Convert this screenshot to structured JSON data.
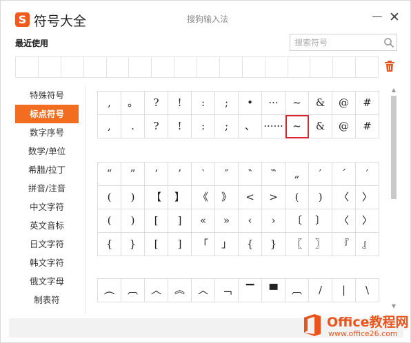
{
  "titlebar": {
    "logo_text": "S",
    "title": "符号大全",
    "center_title": "搜狗输入法",
    "minimize_label": "—",
    "close_label": "✕"
  },
  "recent": {
    "label": "最近使用",
    "cells": 16
  },
  "search": {
    "placeholder": "搜索符号",
    "value": ""
  },
  "sidebar": {
    "items": [
      {
        "label": "特殊符号",
        "active": false
      },
      {
        "label": "标点符号",
        "active": true
      },
      {
        "label": "数字序号",
        "active": false
      },
      {
        "label": "数学/单位",
        "active": false
      },
      {
        "label": "希腊/拉丁",
        "active": false
      },
      {
        "label": "拼音/注音",
        "active": false
      },
      {
        "label": "中文字符",
        "active": false
      },
      {
        "label": "英文音标",
        "active": false
      },
      {
        "label": "日文字符",
        "active": false
      },
      {
        "label": "韩文字符",
        "active": false
      },
      {
        "label": "俄文字母",
        "active": false
      },
      {
        "label": "制表符",
        "active": false
      }
    ]
  },
  "symbol_groups": [
    {
      "rows": [
        [
          ",",
          "。",
          "?",
          "!",
          ":",
          ";",
          "•",
          "···",
          "~",
          "&",
          "@",
          "#"
        ],
        [
          ",",
          ".",
          "?",
          "!",
          ":",
          ";",
          "、",
          "······",
          "~",
          "&",
          "@",
          "#"
        ]
      ],
      "selected": [
        1,
        8
      ]
    },
    {
      "rows": [
        [
          "“",
          "”",
          "‘",
          "’",
          "‵",
          "″",
          "‶",
          "‷",
          "„",
          "′",
          "´",
          "′"
        ],
        [
          "(",
          ")",
          "【",
          "】",
          "《",
          "》",
          "<",
          ">",
          "(",
          ")",
          "〈",
          "〉"
        ],
        [
          "(",
          ")",
          "[",
          "]",
          "«",
          "»",
          "‹",
          "›",
          "〔",
          "〕",
          "〈",
          "〉"
        ],
        [
          "{",
          "}",
          "[",
          "]",
          "「",
          "」",
          "{",
          "}",
          "〖",
          "〗",
          "『",
          "』"
        ]
      ]
    },
    {
      "rows": [
        [
          "︵",
          "︹",
          "︿",
          "︽",
          "︿",
          "﹁",
          "▔",
          "▀",
          "︹",
          "/",
          "|",
          "\\"
        ]
      ]
    }
  ],
  "watermark": {
    "brand": "Office教程网",
    "url": "www.office26.com"
  },
  "colors": {
    "accent": "#f26d1f",
    "selection_border": "#d9262c",
    "grid_line": "#dcdcdc",
    "brand": "#e8561e"
  }
}
